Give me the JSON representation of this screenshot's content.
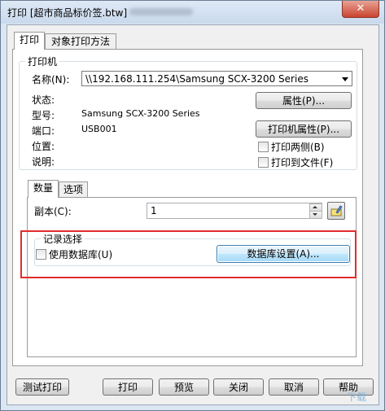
{
  "window": {
    "title": "打印 [超市商品标价签.btw]",
    "close_glyph": "✕"
  },
  "tabs": {
    "print": "打印",
    "object_print": "对象打印方法"
  },
  "printer": {
    "legend": "打印机",
    "name_label": "名称(N):",
    "name_value": "\\\\192.168.111.254\\Samsung SCX-3200 Series",
    "properties_button": "属性(P)...",
    "status_label": "状态:",
    "status_value": "",
    "model_label": "型号:",
    "model_value": "Samsung SCX-3200 Series",
    "port_label": "端口:",
    "port_value": "USB001",
    "location_label": "位置:",
    "comment_label": "说明:",
    "printer_properties_button": "打印机属性(P)...",
    "duplex_label": "打印两侧(B)",
    "duplex_checked": false,
    "to_file_label": "打印到文件(F)",
    "to_file_checked": false
  },
  "inner_tabs": {
    "quantity": "数量",
    "options": "选项"
  },
  "copies": {
    "label": "副本(C):",
    "value": "1"
  },
  "records": {
    "legend": "记录选择",
    "use_db_label": "使用数据库(U)",
    "use_db_checked": false,
    "db_settings_button": "数据库设置(A)..."
  },
  "footer": {
    "test_print": "测试打印",
    "print": "打印",
    "preview": "预览",
    "close": "关闭",
    "cancel": "取消",
    "help": "帮助"
  },
  "watermark": "下载"
}
